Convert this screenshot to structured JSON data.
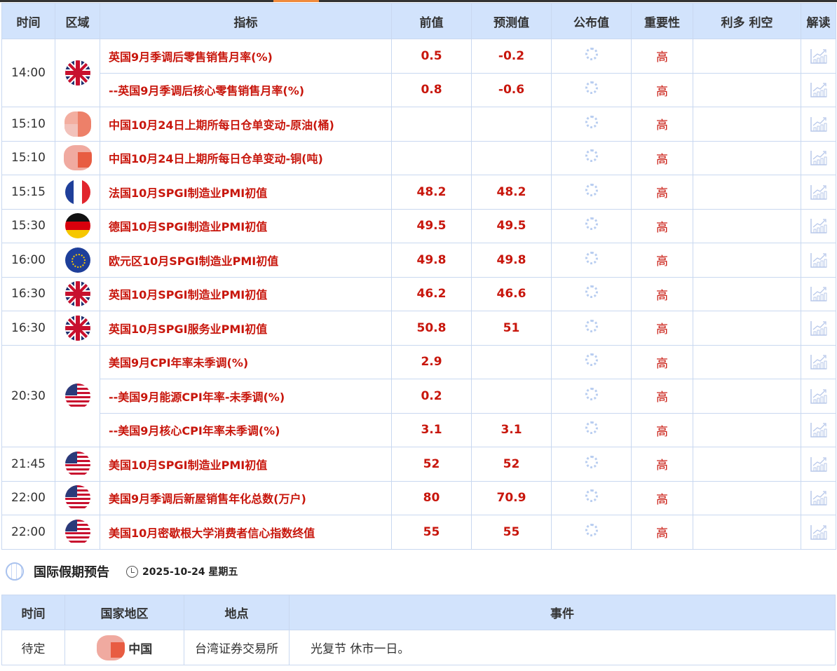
{
  "headers": [
    "时间",
    "区域",
    "指标",
    "前值",
    "预测值",
    "公布值",
    "重要性",
    "利多 利空",
    "解读"
  ],
  "groups": [
    {
      "time": "14:00",
      "flag": "uk",
      "rows": [
        {
          "indicator": "英国9月季调后零售销售月率(%)",
          "prev": "0.5",
          "forecast": "-0.2",
          "importance": "高"
        },
        {
          "indicator": "--英国9月季调后核心零售销售月率(%)",
          "prev": "0.8",
          "forecast": "-0.6",
          "importance": "高"
        }
      ]
    },
    {
      "time": "15:10",
      "flag": "cn",
      "rows": [
        {
          "indicator": "中国10月24日上期所每日仓单变动-原油(桶)",
          "prev": "",
          "forecast": "",
          "importance": "高"
        }
      ]
    },
    {
      "time": "15:10",
      "flag": "cn2",
      "rows": [
        {
          "indicator": "中国10月24日上期所每日仓单变动-铜(吨)",
          "prev": "",
          "forecast": "",
          "importance": "高"
        }
      ]
    },
    {
      "time": "15:15",
      "flag": "fr",
      "rows": [
        {
          "indicator": "法国10月SPGI制造业PMI初值",
          "prev": "48.2",
          "forecast": "48.2",
          "importance": "高"
        }
      ]
    },
    {
      "time": "15:30",
      "flag": "de",
      "rows": [
        {
          "indicator": "德国10月SPGI制造业PMI初值",
          "prev": "49.5",
          "forecast": "49.5",
          "importance": "高"
        }
      ]
    },
    {
      "time": "16:00",
      "flag": "eu",
      "rows": [
        {
          "indicator": "欧元区10月SPGI制造业PMI初值",
          "prev": "49.8",
          "forecast": "49.8",
          "importance": "高"
        }
      ]
    },
    {
      "time": "16:30",
      "flag": "uk",
      "rows": [
        {
          "indicator": "英国10月SPGI制造业PMI初值",
          "prev": "46.2",
          "forecast": "46.6",
          "importance": "高"
        }
      ]
    },
    {
      "time": "16:30",
      "flag": "uk",
      "rows": [
        {
          "indicator": "英国10月SPGI服务业PMI初值",
          "prev": "50.8",
          "forecast": "51",
          "importance": "高"
        }
      ]
    },
    {
      "time": "20:30",
      "flag": "us",
      "rows": [
        {
          "indicator": "美国9月CPI年率未季调(%)",
          "prev": "2.9",
          "forecast": "",
          "importance": "高"
        },
        {
          "indicator": "--美国9月能源CPI年率-未季调(%)",
          "prev": "0.2",
          "forecast": "",
          "importance": "高"
        },
        {
          "indicator": "--美国9月核心CPI年率未季调(%)",
          "prev": "3.1",
          "forecast": "3.1",
          "importance": "高"
        }
      ]
    },
    {
      "time": "21:45",
      "flag": "us",
      "rows": [
        {
          "indicator": "美国10月SPGI制造业PMI初值",
          "prev": "52",
          "forecast": "52",
          "importance": "高"
        }
      ]
    },
    {
      "time": "22:00",
      "flag": "us",
      "rows": [
        {
          "indicator": "美国9月季调后新屋销售年化总数(万户)",
          "prev": "80",
          "forecast": "70.9",
          "importance": "高"
        }
      ]
    },
    {
      "time": "22:00",
      "flag": "us",
      "rows": [
        {
          "indicator": "美国10月密歇根大学消费者信心指数终值",
          "prev": "55",
          "forecast": "55",
          "importance": "高"
        }
      ]
    }
  ],
  "holiday": {
    "title": "国际假期预告",
    "date": "2025-10-24 星期五",
    "headers": [
      "时间",
      "国家地区",
      "地点",
      "事件"
    ],
    "rows": [
      {
        "time": "待定",
        "country": "中国",
        "place": "台湾证券交易所",
        "event": "光复节 休市一日。"
      }
    ]
  },
  "colors": {
    "accent": "#c8160c",
    "header_bg": "#d2e3fc",
    "border": "#c9d8f0"
  }
}
